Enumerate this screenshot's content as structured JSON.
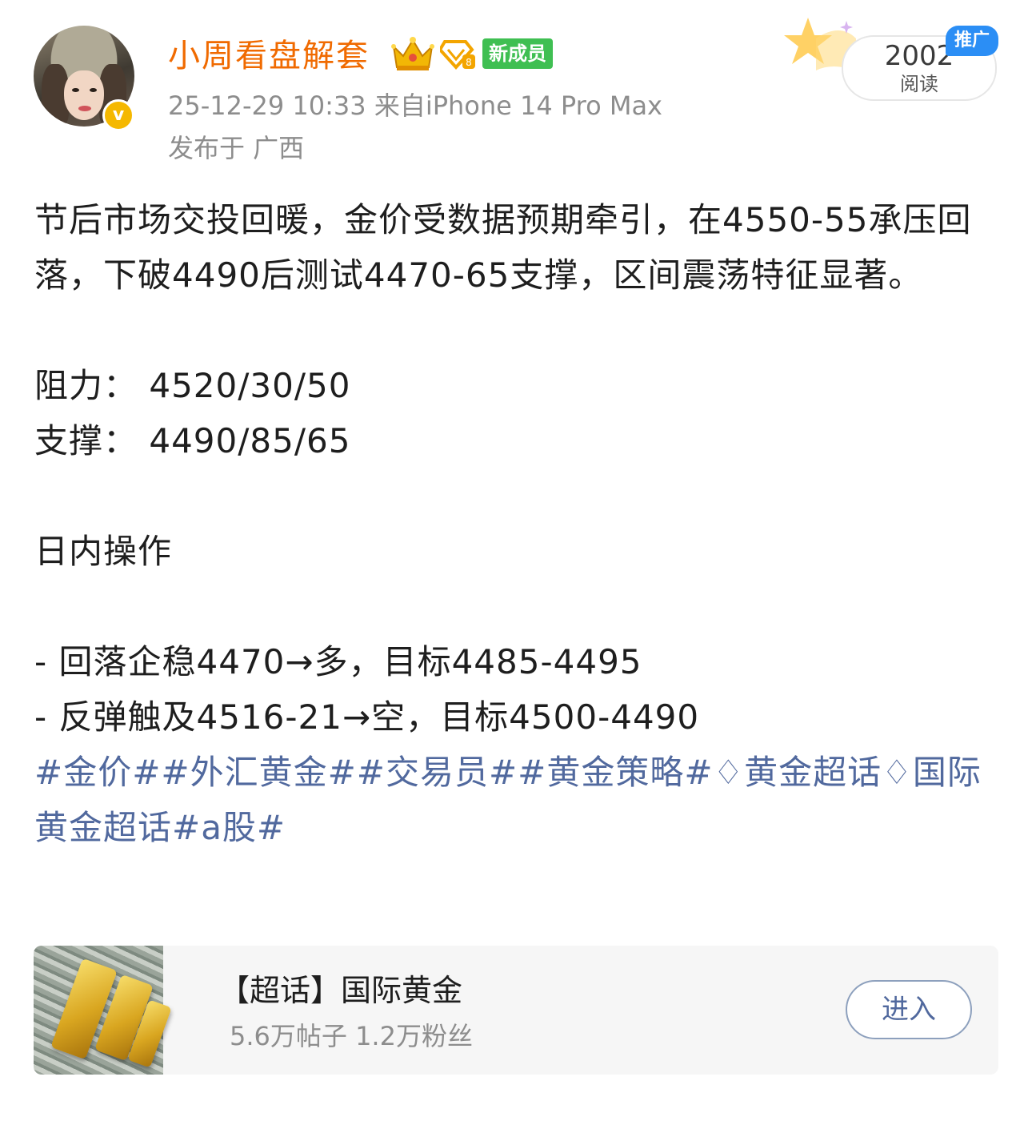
{
  "author": {
    "username": "小周看盘解套",
    "badge_new_member": "新成员",
    "verified_mark": "v",
    "icons": [
      "crown-icon",
      "diamond-badge-icon",
      "verified-icon"
    ]
  },
  "meta": {
    "time_source": "25-12-29 10:33  来自iPhone 14 Pro Max",
    "location": "发布于 广西"
  },
  "reads": {
    "count": "2002",
    "label": "阅读",
    "promo_tag": "推广"
  },
  "post": {
    "paragraph1": "节后市场交投回暖，金价受数据预期牵引，在4550-55承压回落，下破4490后测试4470-65支撑，区间震荡特征显著。",
    "resistance": "阻力：  4520/30/50",
    "support": "支撑：  4490/85/65",
    "intraday_heading": "日内操作",
    "trade1": "- 回落企稳4470→多，目标4485-4495",
    "trade2": "- 反弹触及4516-21→空，目标4500-4490",
    "hashtags": "#金价##外汇黄金##交易员##黄金策略#♢黄金超话♢国际黄金超话#a股#"
  },
  "topic_card": {
    "title": "【超话】国际黄金",
    "stats": "5.6万帖子 1.2万粉丝",
    "enter_label": "进入"
  },
  "colors": {
    "username": "#f06a00",
    "link": "#51699e",
    "meta": "#8d8d8d",
    "new_member_badge": "#3fbf52",
    "promo_tag": "#2b8ef5"
  }
}
